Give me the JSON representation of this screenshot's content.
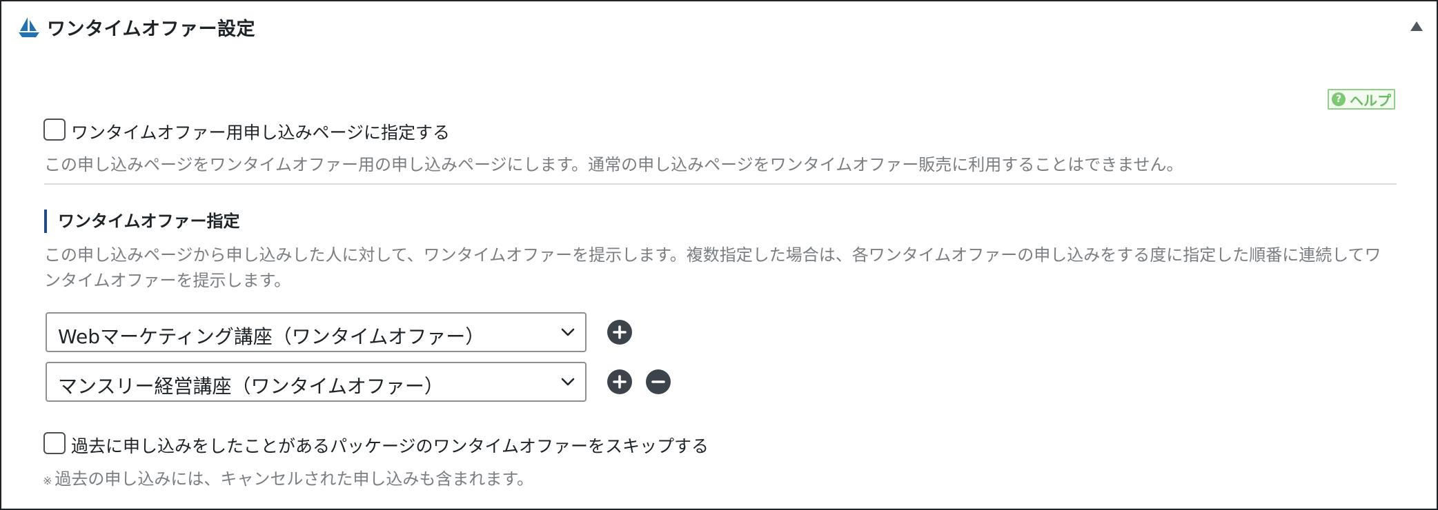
{
  "panel": {
    "title": "ワンタイムオファー設定",
    "help_label": "ヘルプ"
  },
  "onetime_page": {
    "checkbox_label": "ワンタイムオファー用申し込みページに指定する",
    "checked": false,
    "description": "この申し込みページをワンタイムオファー用の申し込みページにします。通常の申し込みページをワンタイムオファー販売に利用することはできません。"
  },
  "onetime_offer": {
    "section_title": "ワンタイムオファー指定",
    "description": "この申し込みページから申し込みした人に対して、ワンタイムオファーを提示します。複数指定した場合は、各ワンタイムオファーの申し込みをする度に指定した順番に連続してワンタイムオファーを提示します。",
    "selects": [
      {
        "value": "Webマーケティング講座（ワンタイムオファー）"
      },
      {
        "value": "マンスリー経営講座（ワンタイムオファー）"
      }
    ]
  },
  "skip": {
    "checkbox_label": "過去に申し込みをしたことがあるパッケージのワンタイムオファーをスキップする",
    "checked": false,
    "note_mark": "※",
    "note": "過去の申し込みには、キャンセルされた申し込みも含まれます。"
  },
  "icons": {
    "title_icon": "sailboat-icon",
    "collapse_icon": "triangle-up-icon",
    "help_icon": "question-circle-icon",
    "add_icon": "plus-circle-icon",
    "remove_icon": "minus-circle-icon",
    "select_arrow": "chevron-down-icon"
  },
  "colors": {
    "accent_bar": "#1e4a8c",
    "help_green": "#6cbc63",
    "button_dark": "#3c434a",
    "icon_blue": "#1e6fc4"
  }
}
